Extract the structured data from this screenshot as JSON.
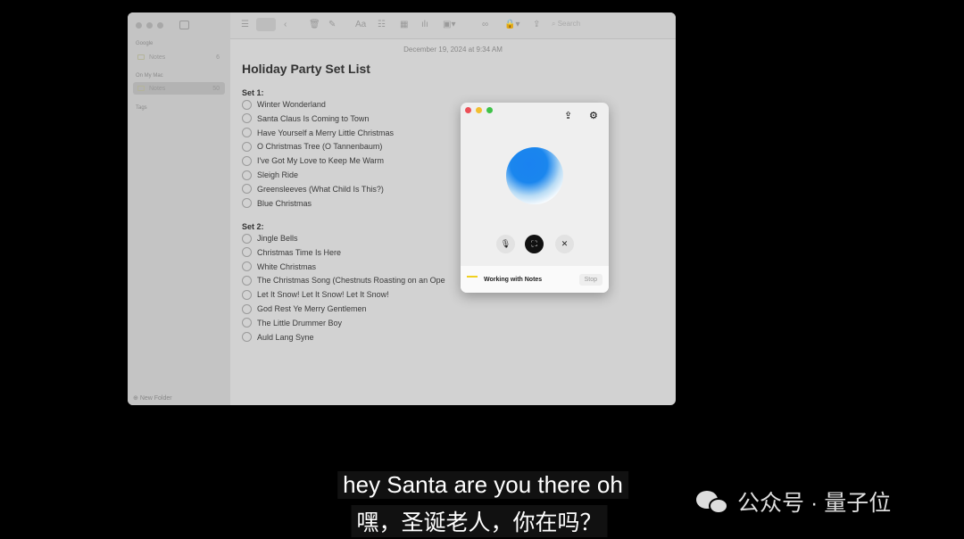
{
  "sidebar": {
    "sections": [
      {
        "label": "Google",
        "items": [
          {
            "label": "Notes",
            "count": "6"
          }
        ]
      },
      {
        "label": "On My Mac",
        "items": [
          {
            "label": "Notes",
            "count": "50"
          }
        ]
      },
      {
        "label": "Tags"
      }
    ],
    "new_folder": "New Folder"
  },
  "toolbar": {
    "search_placeholder": "Search",
    "format_label": "Aa"
  },
  "note": {
    "date": "December 19, 2024 at 9:34 AM",
    "title": "Holiday Party Set List",
    "set1": {
      "label": "Set 1:",
      "items": [
        "Winter Wonderland",
        "Santa Claus Is Coming to Town",
        "Have Yourself a Merry Little Christmas",
        "O Christmas Tree (O Tannenbaum)",
        "I've Got My Love to Keep Me Warm",
        "Sleigh Ride",
        "Greensleeves (What Child Is This?)",
        "Blue Christmas"
      ]
    },
    "set2": {
      "label": "Set 2:",
      "items": [
        "Jingle Bells",
        "Christmas Time Is Here",
        "White Christmas",
        "The Christmas Song (Chestnuts Roasting on an Ope",
        "Let It Snow! Let It Snow! Let It Snow!",
        "God Rest Ye Merry Gentlemen",
        "The Little Drummer Boy",
        "Auld Lang Syne"
      ]
    }
  },
  "assistant": {
    "status": "Working with Notes",
    "stop": "Stop",
    "colors": {
      "orb": "#1a82f0"
    }
  },
  "subtitles": {
    "en": "hey Santa are you there oh",
    "zh": "嘿，圣诞老人，你在吗？"
  },
  "watermark": "公众号 · 量子位"
}
